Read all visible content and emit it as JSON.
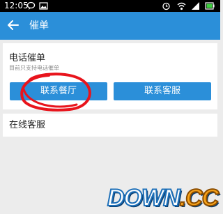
{
  "status_bar": {
    "time": "12:05",
    "icons_left": [
      "chat-bubble-icon",
      "image-icon"
    ],
    "icons_right": [
      "alarm-icon",
      "wifi-icon",
      "signal-icon",
      "battery-icon"
    ]
  },
  "header": {
    "back_icon": "arrow-left-icon",
    "title": "催单"
  },
  "phone_section": {
    "title": "电话催单",
    "subtitle": "目前只支持电话催单",
    "buttons": {
      "contact_restaurant": "联系餐厅",
      "contact_service": "联系客服"
    }
  },
  "online_section": {
    "label": "在线客服"
  },
  "watermark": {
    "main": "DOWN",
    "suffix": ".CC"
  },
  "colors": {
    "accent": "#2b8fd9",
    "annotation": "#e8141c",
    "background": "#ececec"
  }
}
